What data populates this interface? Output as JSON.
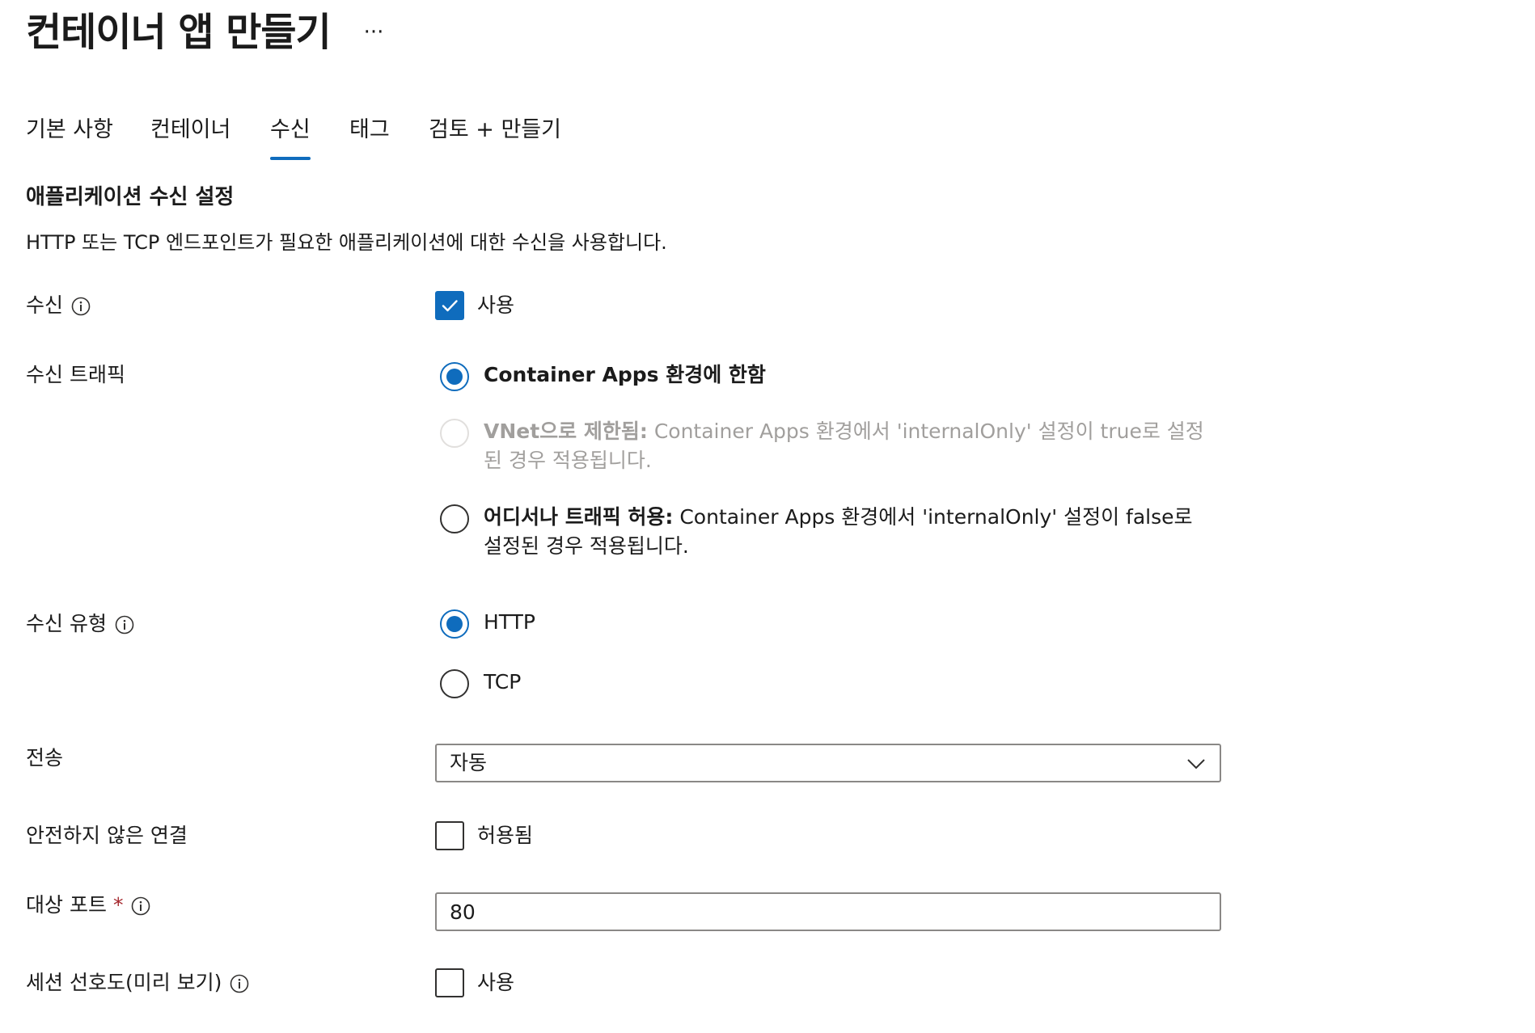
{
  "page": {
    "title": "컨테이너 앱 만들기",
    "more_label": "···"
  },
  "tabs": [
    {
      "label": "기본 사항",
      "selected": false
    },
    {
      "label": "컨테이너",
      "selected": false
    },
    {
      "label": "수신",
      "selected": true
    },
    {
      "label": "태그",
      "selected": false
    },
    {
      "label": "검토 + 만들기",
      "selected": false
    }
  ],
  "section": {
    "title": "애플리케이션 수신 설정",
    "description": "HTTP 또는 TCP 엔드포인트가 필요한 애플리케이션에 대한 수신을 사용합니다."
  },
  "ingress": {
    "label": "수신",
    "checked": true,
    "option_label": "사용"
  },
  "ingress_traffic": {
    "label": "수신 트래픽",
    "options": [
      {
        "bold": "Container Apps 환경에 한함",
        "text": "",
        "selected": true,
        "disabled": false
      },
      {
        "bold": "VNet으로 제한됨:",
        "text": " Container Apps 환경에서 'internalOnly' 설정이 true로 설정된 경우 적용됩니다.",
        "selected": false,
        "disabled": true
      },
      {
        "bold": "어디서나 트래픽 허용:",
        "text": " Container Apps 환경에서 'internalOnly' 설정이 false로 설정된 경우 적용됩니다.",
        "selected": false,
        "disabled": false
      }
    ]
  },
  "ingress_type": {
    "label": "수신 유형",
    "options": [
      {
        "label": "HTTP",
        "selected": true
      },
      {
        "label": "TCP",
        "selected": false
      }
    ]
  },
  "transport": {
    "label": "전송",
    "value": "자동"
  },
  "insecure_connections": {
    "label": "안전하지 않은 연결",
    "checked": false,
    "option_label": "허용됨"
  },
  "target_port": {
    "label": "대상 포트",
    "required_marker": "*",
    "value": "80"
  },
  "session_affinity": {
    "label": "세션 선호도(미리 보기)",
    "checked": false,
    "option_label": "사용"
  },
  "colors": {
    "accent": "#0f6cbd",
    "required": "#a4262c",
    "disabled_text": "#a19f9d"
  },
  "icons": {
    "info": "info-circle-icon",
    "check": "checkmark-icon",
    "chevron": "chevron-down-icon"
  }
}
